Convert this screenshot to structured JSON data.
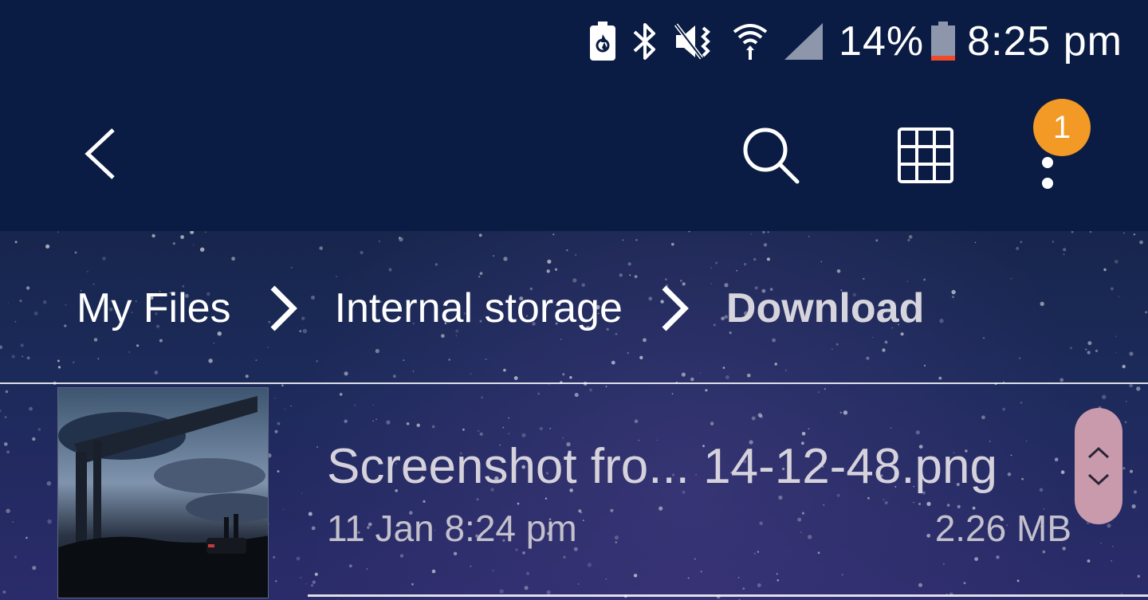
{
  "status_bar": {
    "icons": [
      "battery-saver-icon",
      "bluetooth-icon",
      "vibrate-mute-icon",
      "wifi-icon",
      "cellular-signal-icon"
    ],
    "battery_percent": "14%",
    "battery_level": 0.14,
    "time": "8:25 pm",
    "background": "#0a1c44"
  },
  "toolbar": {
    "icons": [
      "back-icon",
      "search-icon",
      "grid-view-icon",
      "more-options-icon"
    ],
    "notification_badge": "1",
    "badge_color": "#f29a25"
  },
  "breadcrumb": {
    "items": [
      "My Files",
      "Internal storage",
      "Download"
    ]
  },
  "files": [
    {
      "name": "Screenshot fro... 14-12-48.png",
      "date": "11 Jan 8:24 pm",
      "size": "2.26 MB"
    }
  ],
  "scroller": {
    "icons": [
      "chevron-up-icon",
      "chevron-down-icon"
    ],
    "color": "#c89aac"
  }
}
